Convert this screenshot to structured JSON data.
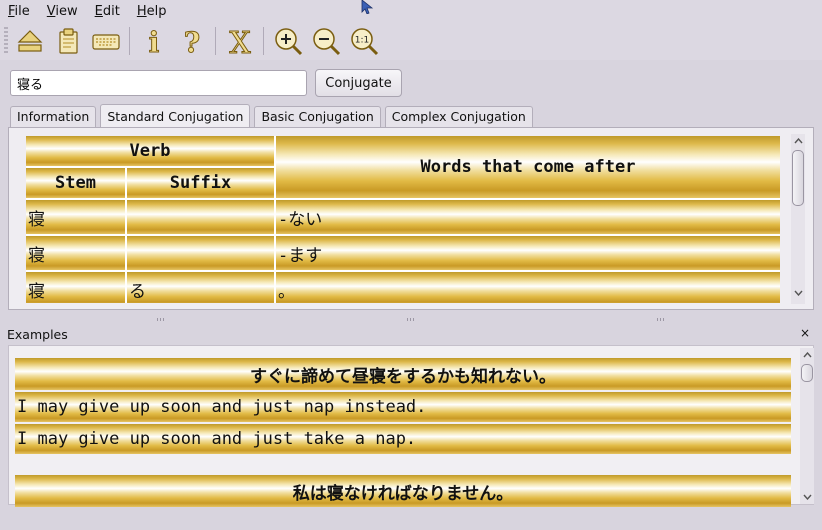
{
  "menu": [
    {
      "label": "File",
      "mnemonic": "F",
      "rest": "ile"
    },
    {
      "label": "View",
      "mnemonic": "V",
      "rest": "iew"
    },
    {
      "label": "Edit",
      "mnemonic": "E",
      "rest": "dit"
    },
    {
      "label": "Help",
      "mnemonic": "H",
      "rest": "elp"
    }
  ],
  "toolbar": {
    "icons": [
      "eject-icon",
      "paste-icon",
      "keyboard-icon",
      "info-icon",
      "help-icon",
      "clear-icon",
      "zoom-in-icon",
      "zoom-out-icon",
      "zoom-reset-icon"
    ],
    "info_glyph": "i",
    "help_glyph": "?",
    "clear_glyph": "X",
    "zoom_reset_glyph": "1:1"
  },
  "search": {
    "value": "寝る"
  },
  "conjugate_button": "Conjugate",
  "tabs": [
    {
      "label": "Information",
      "active": false
    },
    {
      "label": "Standard Conjugation",
      "active": true
    },
    {
      "label": "Basic Conjugation",
      "active": false
    },
    {
      "label": "Complex Conjugation",
      "active": false
    }
  ],
  "table": {
    "header_verb": "Verb",
    "header_stem": "Stem",
    "header_suffix": "Suffix",
    "header_after": "Words that come after",
    "rows": [
      {
        "stem": "寝",
        "suffix": "",
        "after": "-ない"
      },
      {
        "stem": "寝",
        "suffix": "",
        "after": "-ます"
      },
      {
        "stem": "寝",
        "suffix": "る",
        "after": "。"
      }
    ]
  },
  "examples": {
    "title": "Examples",
    "close_glyph": "×",
    "lines": [
      {
        "text": "すぐに諦めて昼寝をするかも知れない。",
        "kind": "jp"
      },
      {
        "text": "I may give up soon and just nap instead.",
        "kind": "en"
      },
      {
        "text": "I may give up soon and just take a nap.",
        "kind": "en"
      },
      {
        "text": "私は寝なければなりません。",
        "kind": "jp"
      }
    ]
  },
  "colors": {
    "gold": "#d9b33f",
    "window_bg": "#d8d4de"
  }
}
